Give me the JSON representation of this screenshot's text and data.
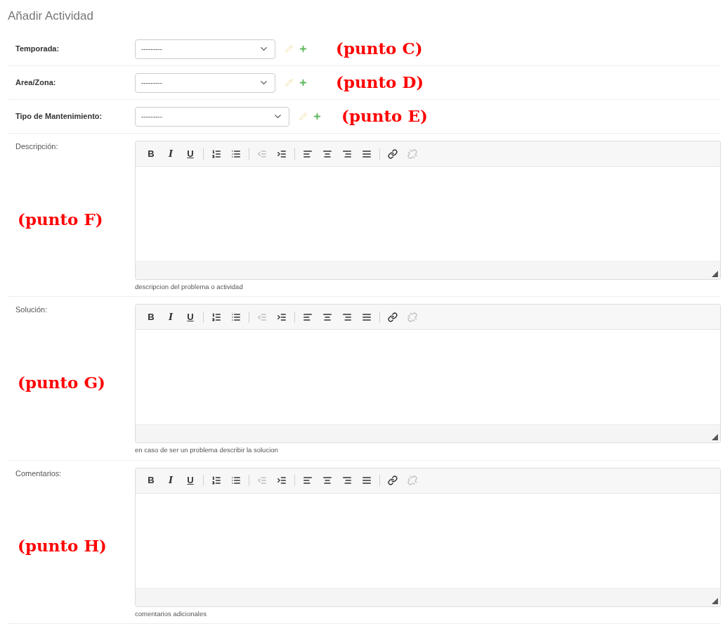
{
  "title": "Añadir Actividad",
  "selects": [
    {
      "label": "Temporada:",
      "value": "---------",
      "annotation": "(punto C)"
    },
    {
      "label": "Area/Zona:",
      "value": "---------",
      "annotation": "(punto D)"
    },
    {
      "label": "Tipo de Mantenimiento:",
      "value": "---------",
      "annotation": "(punto E)"
    }
  ],
  "editors": [
    {
      "label": "Descripción:",
      "help": "descripcion del problema o actividad",
      "annotation": "(punto F)",
      "toolbar": [
        {
          "kind": "bold",
          "label": "B",
          "disabled": false
        },
        {
          "kind": "italic",
          "label": "I",
          "disabled": false
        },
        {
          "kind": "underline",
          "label": "U",
          "disabled": false
        },
        {
          "kind": "separator"
        },
        {
          "kind": "ordered_list",
          "disabled": false
        },
        {
          "kind": "bullet_list",
          "disabled": false
        },
        {
          "kind": "separator"
        },
        {
          "kind": "outdent",
          "disabled": true
        },
        {
          "kind": "indent",
          "disabled": false
        },
        {
          "kind": "separator"
        },
        {
          "kind": "align_left",
          "disabled": false
        },
        {
          "kind": "align_center",
          "disabled": false
        },
        {
          "kind": "align_right",
          "disabled": false
        },
        {
          "kind": "justify",
          "disabled": false
        },
        {
          "kind": "separator"
        },
        {
          "kind": "link",
          "disabled": false
        },
        {
          "kind": "unlink",
          "disabled": true
        }
      ]
    },
    {
      "label": "Solución:",
      "help": "en caso de ser un problema describir la solucion",
      "annotation": "(punto G)",
      "toolbar": [
        {
          "kind": "bold",
          "label": "B",
          "disabled": false
        },
        {
          "kind": "italic",
          "label": "I",
          "disabled": false
        },
        {
          "kind": "underline",
          "label": "U",
          "disabled": false
        },
        {
          "kind": "separator"
        },
        {
          "kind": "ordered_list",
          "disabled": false
        },
        {
          "kind": "bullet_list",
          "disabled": false
        },
        {
          "kind": "separator"
        },
        {
          "kind": "outdent",
          "disabled": true
        },
        {
          "kind": "indent",
          "disabled": false
        },
        {
          "kind": "separator"
        },
        {
          "kind": "align_left",
          "disabled": false
        },
        {
          "kind": "align_center",
          "disabled": false
        },
        {
          "kind": "align_right",
          "disabled": false
        },
        {
          "kind": "justify",
          "disabled": false
        },
        {
          "kind": "separator"
        },
        {
          "kind": "link",
          "disabled": false
        },
        {
          "kind": "unlink",
          "disabled": true
        }
      ]
    },
    {
      "label": "Comentarios:",
      "help": "comentarios adicionales",
      "annotation": "(punto H)",
      "toolbar": [
        {
          "kind": "bold",
          "label": "B",
          "disabled": false
        },
        {
          "kind": "italic",
          "label": "I",
          "disabled": false
        },
        {
          "kind": "underline",
          "label": "U",
          "disabled": false
        },
        {
          "kind": "separator"
        },
        {
          "kind": "ordered_list",
          "disabled": false
        },
        {
          "kind": "bullet_list",
          "disabled": false
        },
        {
          "kind": "separator"
        },
        {
          "kind": "outdent",
          "disabled": true
        },
        {
          "kind": "indent",
          "disabled": false
        },
        {
          "kind": "separator"
        },
        {
          "kind": "align_left",
          "disabled": false
        },
        {
          "kind": "align_center",
          "disabled": false
        },
        {
          "kind": "align_right",
          "disabled": false
        },
        {
          "kind": "justify",
          "disabled": false
        },
        {
          "kind": "separator"
        },
        {
          "kind": "link",
          "disabled": false
        },
        {
          "kind": "unlink",
          "disabled": true
        }
      ]
    }
  ]
}
